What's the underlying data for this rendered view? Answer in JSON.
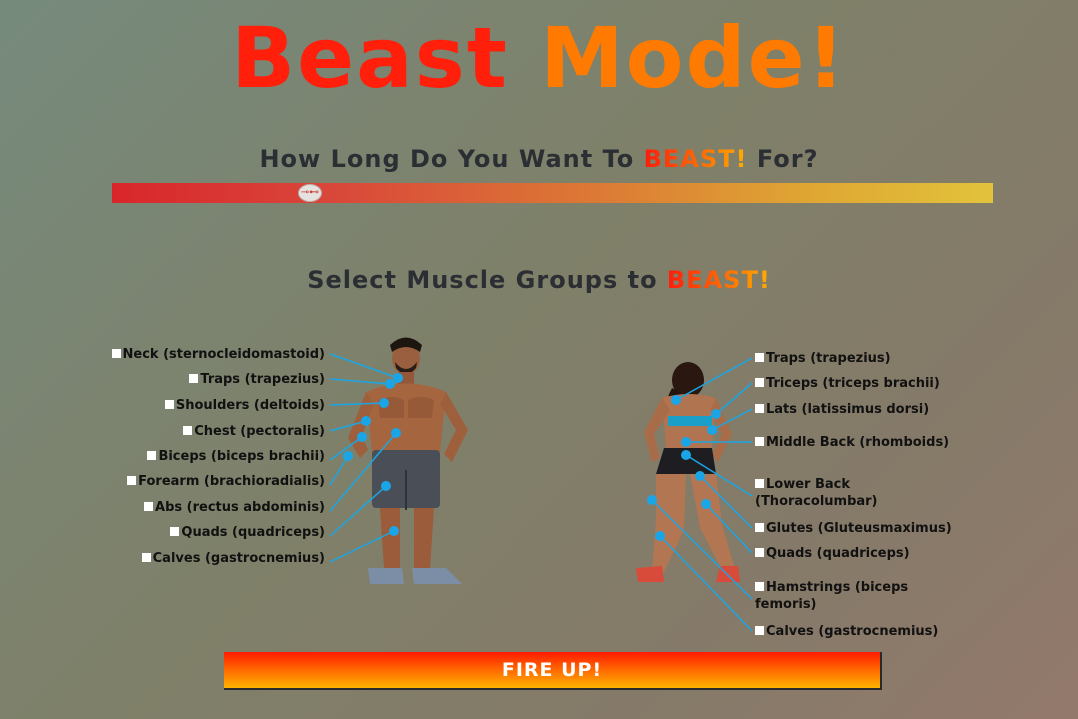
{
  "title": {
    "part1": "Beast ",
    "part2": "Mode!"
  },
  "duration": {
    "question_pre": "How Long Do You Want To ",
    "question_beast": "BEAST!",
    "question_post": " For?",
    "slider_fraction": 0.225
  },
  "muscles": {
    "heading_pre": "Select Muscle Groups to ",
    "heading_beast": "BEAST!",
    "front": [
      "Neck (sternocleidomastoid)",
      "Traps (trapezius)",
      "Shoulders (deltoids)",
      "Chest (pectoralis)",
      "Biceps (biceps brachii)",
      "Forearm (brachioradialis)",
      "Abs (rectus abdominis)",
      "Quads (quadriceps)",
      "Calves (gastrocnemius)"
    ],
    "back": [
      "Traps (trapezius)",
      "Triceps (triceps brachii)",
      "Lats (latissimus dorsi)",
      "Middle Back (rhomboids)",
      [
        "Lower Back",
        "(Thoracolumbar)"
      ],
      "Glutes (Gluteusmaximus)",
      "Quads (quadriceps)",
      [
        "Hamstrings (biceps",
        "femoris)"
      ],
      "Calves (gastrocnemius)"
    ]
  },
  "submit": {
    "label": "FIRE UP!"
  },
  "colors": {
    "accent": "#ff1f0a",
    "marker": "#1aa6e6"
  }
}
